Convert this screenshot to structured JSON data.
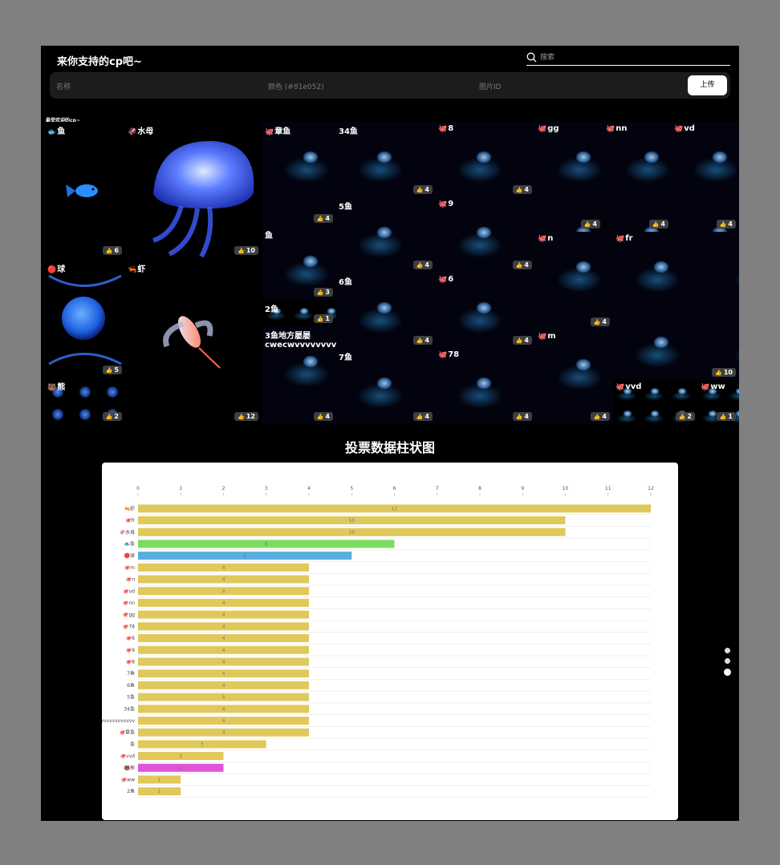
{
  "header": {
    "title": "来你支持的cp吧~",
    "search_placeholder": "搜索"
  },
  "upload": {
    "name_placeholder": "名称",
    "color_placeholder": "颜色 (#81e052)",
    "id_placeholder": "图片ID",
    "button_label": "上传"
  },
  "gallery": {
    "heading": "最受欢迎的cp~",
    "tiles": [
      {
        "icon": "🐟",
        "name": "鱼",
        "likes": "6"
      },
      {
        "icon": "🦑",
        "name": "水母",
        "likes": "10"
      },
      {
        "icon": "🔴",
        "name": "球",
        "likes": "5"
      },
      {
        "icon": "🦐",
        "name": "虾",
        "likes": "12"
      },
      {
        "icon": "🐻",
        "name": "熊",
        "likes": "2"
      },
      {
        "icon": "🐙",
        "name": "章鱼",
        "likes": "4"
      },
      {
        "icon": "",
        "name": "34鱼",
        "likes": "4"
      },
      {
        "icon": "🐙",
        "name": "8",
        "likes": "4"
      },
      {
        "icon": "🐙",
        "name": "gg",
        "likes": "4"
      },
      {
        "icon": "🐙",
        "name": "nn",
        "likes": "4"
      },
      {
        "icon": "🐙",
        "name": "vd",
        "likes": "4"
      },
      {
        "icon": "",
        "name": "鱼",
        "likes": "3"
      },
      {
        "icon": "",
        "name": "5鱼",
        "likes": "4"
      },
      {
        "icon": "🐙",
        "name": "9",
        "likes": "4"
      },
      {
        "icon": "🐙",
        "name": "n",
        "likes": "4"
      },
      {
        "icon": "🐙",
        "name": "fr",
        "likes": "10"
      },
      {
        "icon": "",
        "name": "2鱼",
        "likes": "1"
      },
      {
        "icon": "",
        "name": "6鱼",
        "likes": "4"
      },
      {
        "icon": "🐙",
        "name": "6",
        "likes": "4"
      },
      {
        "icon": "🐙",
        "name": "m",
        "likes": "4"
      },
      {
        "icon": "",
        "name": "3鱼地方屡屡\ncwecwvvvvvvvvvvv",
        "likes": "4"
      },
      {
        "icon": "",
        "name": "7鱼",
        "likes": "4"
      },
      {
        "icon": "🐙",
        "name": "78",
        "likes": "4"
      },
      {
        "icon": "🐙",
        "name": "vvd",
        "likes": "2"
      },
      {
        "icon": "🐙",
        "name": "ww",
        "likes": "1"
      }
    ]
  },
  "chart_title": "投票数据柱状图",
  "colors": {
    "bar_default": "#e0c95a",
    "bar_fish": "#7ddc5f",
    "bar_ball": "#5aaee0",
    "bar_bear": "#e054d8"
  },
  "chart_data": {
    "type": "bar",
    "orientation": "horizontal",
    "title": "",
    "xlim": [
      0,
      12
    ],
    "xticks": [
      0,
      1,
      2,
      3,
      4,
      5,
      6,
      7,
      8,
      9,
      10,
      11,
      12
    ],
    "grid": true,
    "categories": [
      "🦐虾",
      "🐙fr",
      "🦑水母",
      "🐟鱼",
      "🔴球",
      "🐙m",
      "🐙n",
      "🐙vd",
      "🐙nn",
      "🐙gg",
      "🐙78",
      "🐙6",
      "🐙9",
      "🐙8",
      "7鱼",
      "6鱼",
      "5鱼",
      "34鱼",
      "cwecwvvvvvvvvvvv",
      "🐙章鱼",
      "鱼",
      "🐙vvd",
      "🐻熊",
      "🐙ww",
      "2鱼"
    ],
    "values": [
      12,
      10,
      10,
      6,
      5,
      4,
      4,
      4,
      4,
      4,
      4,
      4,
      4,
      4,
      4,
      4,
      4,
      4,
      4,
      4,
      3,
      2,
      2,
      1,
      1
    ],
    "bar_colors": [
      "#e0c95a",
      "#e0c95a",
      "#e0c95a",
      "#7ddc5f",
      "#5aaee0",
      "#e0c95a",
      "#e0c95a",
      "#e0c95a",
      "#e0c95a",
      "#e0c95a",
      "#e0c95a",
      "#e0c95a",
      "#e0c95a",
      "#e0c95a",
      "#e0c95a",
      "#e0c95a",
      "#e0c95a",
      "#e0c95a",
      "#e0c95a",
      "#e0c95a",
      "#e0c95a",
      "#e0c95a",
      "#e054d8",
      "#e0c95a",
      "#e0c95a"
    ]
  },
  "pagination": {
    "count": 3,
    "active": 3
  }
}
